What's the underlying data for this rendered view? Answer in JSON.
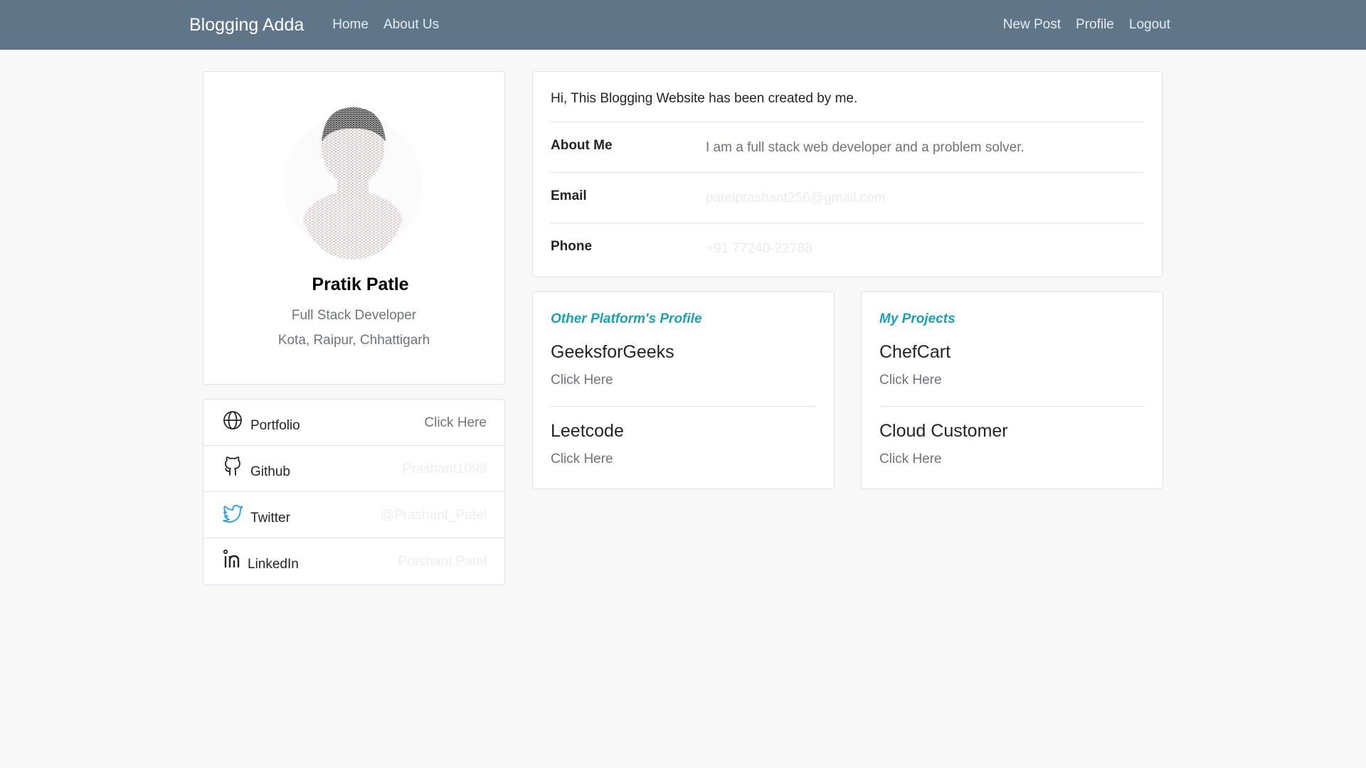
{
  "navbar": {
    "brand": "Blogging Adda",
    "left_links": [
      "Home",
      "About Us"
    ],
    "right_links": [
      "New Post",
      "Profile",
      "Logout"
    ]
  },
  "profile": {
    "name": "Pratik Patle",
    "role": "Full Stack Developer",
    "location": "Kota, Raipur, Chhattigarh"
  },
  "social": [
    {
      "label": "Portfolio",
      "value": "Click Here",
      "icon": "globe-icon"
    },
    {
      "label": "Github",
      "value": "Prashant1099",
      "icon": "github-icon"
    },
    {
      "label": "Twitter",
      "value": "@Prashant_Patel",
      "icon": "twitter-icon"
    },
    {
      "label": "LinkedIn",
      "value": "Prashant Patel",
      "icon": "linkedin-icon"
    }
  ],
  "details": {
    "intro": "Hi, This Blogging Website has been created by me.",
    "rows": [
      {
        "label": "About Me",
        "value": "I am a full stack web developer and a problem solver."
      },
      {
        "label": "Email",
        "value": "patelprashant256@gmail.com"
      },
      {
        "label": "Phone",
        "value": "+91 77240-22788"
      }
    ]
  },
  "platforms": {
    "heading": "Other Platform's Profile",
    "items": [
      {
        "title": "GeeksforGeeks",
        "link": "Click Here"
      },
      {
        "title": "Leetcode",
        "link": "Click Here"
      }
    ]
  },
  "projects": {
    "heading": "My Projects",
    "items": [
      {
        "title": "ChefCart",
        "link": "Click Here"
      },
      {
        "title": "Cloud Customer",
        "link": "Click Here"
      }
    ]
  },
  "colors": {
    "navbar": "#5f7689",
    "accent": "#17a2b8",
    "twitter": "#1da1f2",
    "page_bg": "#f8f8f8"
  }
}
